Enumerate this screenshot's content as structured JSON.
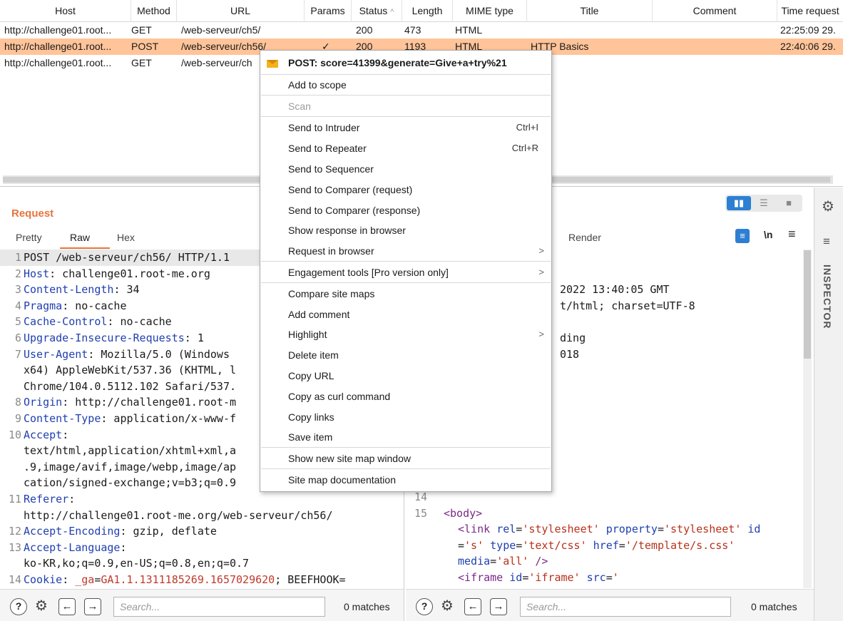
{
  "table": {
    "columns": [
      "Host",
      "Method",
      "URL",
      "Params",
      "Status",
      "Length",
      "MIME type",
      "Title",
      "Comment",
      "Time request"
    ],
    "rows": [
      {
        "host": "http://challenge01.root...",
        "method": "GET",
        "url": "/web-serveur/ch5/",
        "params": "",
        "status": "200",
        "length": "473",
        "mime": "HTML",
        "title": "",
        "comment": "",
        "time": "22:25:09 29."
      },
      {
        "host": "http://challenge01.root...",
        "method": "POST",
        "url": "/web-serveur/ch56/",
        "params": "✓",
        "status": "200",
        "length": "1193",
        "mime": "HTML",
        "title": "HTTP Basics",
        "comment": "",
        "time": "22:40:06 29."
      },
      {
        "host": "http://challenge01.root...",
        "method": "GET",
        "url": "/web-serveur/ch",
        "params": "",
        "status": "",
        "length": "",
        "mime": "",
        "title": "",
        "comment": "",
        "time": ""
      }
    ],
    "sort_icon": "^"
  },
  "context_menu": {
    "header": "POST: score=41399&generate=Give+a+try%21",
    "items": [
      {
        "label": "Add to scope"
      },
      {
        "label": "Scan"
      },
      {
        "label": "Send to Intruder",
        "shortcut": "Ctrl+I"
      },
      {
        "label": "Send to Repeater",
        "shortcut": "Ctrl+R"
      },
      {
        "label": "Send to Sequencer"
      },
      {
        "label": "Send to Comparer (request)"
      },
      {
        "label": "Send to Comparer (response)"
      },
      {
        "label": "Show response in browser"
      },
      {
        "label": "Request in browser"
      },
      {
        "label": "Engagement tools [Pro version only]"
      },
      {
        "label": "Compare site maps"
      },
      {
        "label": "Add comment"
      },
      {
        "label": "Highlight"
      },
      {
        "label": "Delete item"
      },
      {
        "label": "Copy URL"
      },
      {
        "label": "Copy as curl command"
      },
      {
        "label": "Copy links"
      },
      {
        "label": "Save item"
      },
      {
        "label": "Show new site map window"
      },
      {
        "label": "Site map documentation"
      }
    ],
    "submenu_arrow": ">"
  },
  "request": {
    "title": "Request",
    "tabs": [
      "Pretty",
      "Raw",
      "Hex"
    ],
    "lines": [
      {
        "n": "1",
        "text": "POST /web-serveur/ch56/ HTTP/1.1"
      },
      {
        "n": "2",
        "key": "Host",
        "val": ": challenge01.root-me.org"
      },
      {
        "n": "3",
        "key": "Content-Length",
        "val": ": 34"
      },
      {
        "n": "4",
        "key": "Pragma",
        "val": ": no-cache"
      },
      {
        "n": "5",
        "key": "Cache-Control",
        "val": ": no-cache"
      },
      {
        "n": "6",
        "key": "Upgrade-Insecure-Requests",
        "val": ": 1"
      },
      {
        "n": "7",
        "key": "User-Agent",
        "val": ": Mozilla/5.0 (Windows"
      },
      {
        "n": "",
        "text": "x64) AppleWebKit/537.36 (KHTML, l"
      },
      {
        "n": "",
        "text": "Chrome/104.0.5112.102 Safari/537."
      },
      {
        "n": "8",
        "key": "Origin",
        "val": ": http://challenge01.root-m"
      },
      {
        "n": "9",
        "key": "Content-Type",
        "val": ": application/x-www-f"
      },
      {
        "n": "10",
        "key": "Accept",
        "val": ":"
      },
      {
        "n": "",
        "text": "text/html,application/xhtml+xml,a"
      },
      {
        "n": "",
        "text": ".9,image/avif,image/webp,image/ap"
      },
      {
        "n": "",
        "text": "cation/signed-exchange;v=b3;q=0.9"
      },
      {
        "n": "11",
        "key": "Referer",
        "val": ":"
      },
      {
        "n": "",
        "text": "http://challenge01.root-me.org/web-serveur/ch56/"
      },
      {
        "n": "12",
        "key": "Accept-Encoding",
        "val": ": gzip, deflate"
      },
      {
        "n": "13",
        "key": "Accept-Language",
        "val": ":"
      },
      {
        "n": "",
        "text": "ko-KR,ko;q=0.9,en-US;q=0.8,en;q=0.7"
      },
      {
        "n": "14",
        "key": "Cookie",
        "val": ": ",
        "cookie_name": "_ga",
        "cookie_eq": "=",
        "cookie_val": "GA1.1.1311185269.1657029620",
        "cookie_rest": "; BEEFHOOK="
      }
    ],
    "search_placeholder": "Search...",
    "matches": "0 matches"
  },
  "response": {
    "tab_render": "Render",
    "newline_label": "\\n",
    "lines_visible": [
      {
        "text": "2022 13:40:05 GMT"
      },
      {
        "text": "t/html; charset=UTF-8"
      },
      {
        "text": ""
      },
      {
        "text": "ding"
      },
      {
        "text": "018"
      }
    ],
    "tail_lines": [
      {
        "n": "14",
        "html": ""
      },
      {
        "n": "15",
        "tag_open": "<body>"
      }
    ],
    "body_lines": {
      "l1_tag": "<link",
      "l1_a1": "rel",
      "l1_v1": "'stylesheet'",
      "l1_a2": "property",
      "l1_v2": "'stylesheet'",
      "l1_a3": "id",
      "l2_v3": "'s'",
      "l2_a4": "type",
      "l2_v4": "'text/css'",
      "l2_a5": "href",
      "l2_v5": "'/template/s.css'",
      "l3_a6": "media",
      "l3_v6": "'all'",
      "l3_end": "/>",
      "l4_tag": "<iframe",
      "l4_a7": "id",
      "l4_v7": "'iframe'",
      "l4_a8": "src",
      "l4_v8": "'"
    },
    "search_placeholder": "Search...",
    "matches": "0 matches"
  },
  "inspector": {
    "label": "INSPECTOR"
  },
  "icons": {
    "help": "?",
    "settings": "⚙",
    "back": "←",
    "forward": "→",
    "wrap": "wrap-icon",
    "menu": "≡"
  },
  "colors": {
    "accent": "#e8743b",
    "selection": "#ffc499",
    "toggle_on": "#2d7fd3"
  }
}
